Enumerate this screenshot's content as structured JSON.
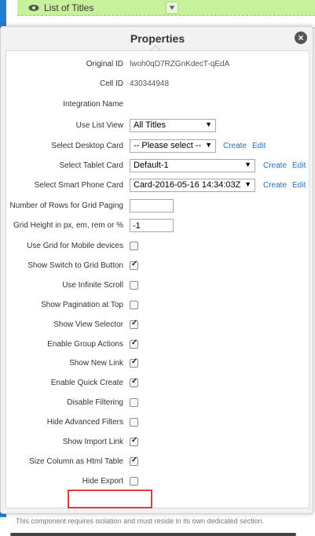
{
  "background": {
    "list_title": "List of Titles"
  },
  "popup": {
    "title": "Properties",
    "close_symbol": "×",
    "fields": {
      "original_id": {
        "label": "Original ID",
        "value": "lwoh0qD7RZGnKdecT-qEdA"
      },
      "cell_id": {
        "label": "Cell ID",
        "value": "430344948"
      },
      "integration_name": {
        "label": "Integration Name",
        "value": ""
      },
      "use_list_view": {
        "label": "Use List View",
        "value": "All Titles"
      },
      "desktop_card": {
        "label": "Select Desktop Card",
        "value": "-- Please select --",
        "create": "Create",
        "edit": "Edit"
      },
      "tablet_card": {
        "label": "Select Tablet Card",
        "value": "Default-1",
        "create": "Create",
        "edit": "Edit"
      },
      "phone_card": {
        "label": "Select Smart Phone Card",
        "value": "Card-2016-05-16 14:34:03Z",
        "create": "Create",
        "edit": "Edit"
      },
      "rows_paging": {
        "label": "Number of Rows for Grid Paging",
        "value": ""
      },
      "grid_height": {
        "label": "Grid Height in px, em, rem or %",
        "value": "-1"
      }
    },
    "checkboxes": [
      {
        "label": "Use Grid for Mobile devices",
        "checked": false
      },
      {
        "label": "Show Switch to Grid Button",
        "checked": true
      },
      {
        "label": "Use Infinite Scroll",
        "checked": false
      },
      {
        "label": "Show Pagination at Top",
        "checked": false
      },
      {
        "label": "Show View Selector",
        "checked": true
      },
      {
        "label": "Enable Group Actions",
        "checked": true
      },
      {
        "label": "Show New Link",
        "checked": true
      },
      {
        "label": "Enable Quick Create",
        "checked": true
      },
      {
        "label": "Disable Filtering",
        "checked": false
      },
      {
        "label": "Hide Advanced Filters",
        "checked": false
      },
      {
        "label": "Show Import Link",
        "checked": true
      },
      {
        "label": "Size Column as Html Table",
        "checked": true
      },
      {
        "label": "Hide Export",
        "checked": false
      }
    ],
    "footer_note": "This component requires isolation and must reside in its own dedicated section."
  },
  "colors": {
    "highlight": "#e03c3c",
    "link": "#2a6fb6",
    "green_bar": "#c7f29b",
    "left_strip": "#1f7fd1"
  }
}
